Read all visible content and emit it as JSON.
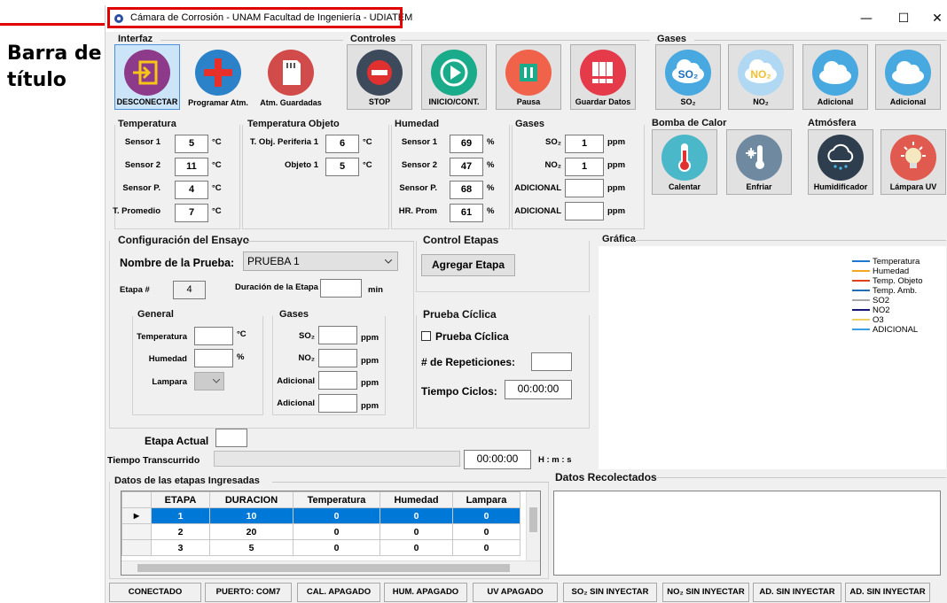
{
  "annotation": {
    "label_line1": "Barra de",
    "label_line2": "título"
  },
  "window": {
    "title": "Cámara de Corrosión - UNAM Facultad de Ingeniería - UDIATEM",
    "minimize": "—",
    "maximize": "☐",
    "close": "✕"
  },
  "groups": {
    "interfaz": "Interfaz",
    "controles": "Controles",
    "gases_top": "Gases",
    "temperatura": "Temperatura",
    "temp_objeto": "Temperatura Objeto",
    "humedad": "Humedad",
    "gases_mid": "Gases",
    "bomba": "Bomba de Calor",
    "atmosfera": "Atmósfera",
    "config": "Configuración del Ensayo",
    "control_etapas": "Control Etapas",
    "grafica": "Gráfica",
    "general": "General",
    "gases_cfg": "Gases",
    "prueba_ciclica": "Prueba Cíclica",
    "datos_etapas": "Datos de las etapas Ingresadas",
    "datos_recolectados": "Datos Recolectados"
  },
  "toolbar": {
    "desconectar": "DESCONECTAR",
    "programar": "Programar Atm.",
    "guardadas": "Atm. Guardadas",
    "stop": "STOP",
    "inicio": "INICIO/CONT.",
    "pausa": "Pausa",
    "guardar_datos": "Guardar Datos",
    "so2": "SO₂",
    "no2": "NO₂",
    "adicional1": "Adicional",
    "adicional2": "Adicional",
    "so2_icon_text": "SO₂",
    "no2_icon_text": "NO₂",
    "calentar": "Calentar",
    "enfriar": "Enfriar",
    "humidificador": "Humidificador",
    "lampara_uv": "Lámpara UV"
  },
  "temperatura": {
    "sensor1_label": "Sensor 1",
    "sensor1_value": "5",
    "sensor1_unit": "°C",
    "sensor2_label": "Sensor 2",
    "sensor2_value": "11",
    "sensor2_unit": "°C",
    "sensorp_label": "Sensor P.",
    "sensorp_value": "4",
    "sensorp_unit": "°C",
    "promedio_label": "T. Promedio",
    "promedio_value": "7",
    "promedio_unit": "°C"
  },
  "temp_objeto": {
    "periferia_label": "T. Obj. Periferia 1",
    "periferia_value": "6",
    "periferia_unit": "°C",
    "objeto_label": "Objeto 1",
    "objeto_value": "5",
    "objeto_unit": "°C"
  },
  "humedad": {
    "sensor1_label": "Sensor 1",
    "sensor1_value": "69",
    "sensor1_unit": "%",
    "sensor2_label": "Sensor 2",
    "sensor2_value": "47",
    "sensor2_unit": "%",
    "sensorp_label": "Sensor P.",
    "sensorp_value": "68",
    "sensorp_unit": "%",
    "prom_label": "HR. Prom",
    "prom_value": "61",
    "prom_unit": "%"
  },
  "gases_mid": {
    "so2_label": "SO₂",
    "so2_value": "1",
    "so2_unit": "ppm",
    "no2_label": "NO₂",
    "no2_value": "1",
    "no2_unit": "ppm",
    "ad1_label": "ADICIONAL",
    "ad1_value": "",
    "ad1_unit": "ppm",
    "ad2_label": "ADICIONAL",
    "ad2_value": "",
    "ad2_unit": "ppm"
  },
  "config": {
    "nombre_label": "Nombre de la Prueba:",
    "nombre_value": "PRUEBA 1",
    "etapa_label": "Etapa #",
    "etapa_value": "4",
    "duracion_label": "Duración de la Etapa",
    "duracion_value": "",
    "duracion_unit": "min",
    "temp_label": "Temperatura",
    "temp_unit": "°C",
    "hum_label": "Humedad",
    "hum_unit": "%",
    "lampara_label": "Lampara",
    "so2_label": "SO₂",
    "no2_label": "NO₂",
    "ad1_label": "Adicional",
    "ad2_label": "Adicional",
    "ppm": "ppm"
  },
  "control_etapas": {
    "agregar": "Agregar Etapa"
  },
  "prueba_ciclica": {
    "checkbox_label": "Prueba Cíclica",
    "repeticiones_label": "# de Repeticiones:",
    "tiempo_label": "Tiempo Ciclos:",
    "tiempo_value": "00:00:00"
  },
  "progress": {
    "etapa_actual_label": "Etapa Actual",
    "etapa_actual_value": "",
    "transcurrido_label": "Tiempo Transcurrido",
    "transcurrido_value": "00:00:00",
    "hms": "H : m : s"
  },
  "legend": [
    {
      "name": "Temperatura",
      "color": "#1f77d4"
    },
    {
      "name": "Humedad",
      "color": "#f5a623"
    },
    {
      "name": "Temp. Objeto",
      "color": "#e0401a"
    },
    {
      "name": "Temp. Amb.",
      "color": "#1e6fb8"
    },
    {
      "name": "SO2",
      "color": "#a8a8a8"
    },
    {
      "name": "NO2",
      "color": "#15157a"
    },
    {
      "name": "O3",
      "color": "#f0d060"
    },
    {
      "name": "ADICIONAL",
      "color": "#3aa0e6"
    }
  ],
  "table": {
    "headers": [
      "ETAPA",
      "DURACION",
      "Temperatura",
      "Humedad",
      "Lampara"
    ],
    "rows": [
      [
        "1",
        "10",
        "0",
        "0",
        "0"
      ],
      [
        "2",
        "20",
        "0",
        "0",
        "0"
      ],
      [
        "3",
        "5",
        "0",
        "0",
        "0"
      ]
    ]
  },
  "status": {
    "conectado": "CONECTADO",
    "puerto": "PUERTO: COM7",
    "cal": "CAL. APAGADO",
    "hum": "HUM. APAGADO",
    "uv": "UV APAGADO",
    "so2": "SO₂ SIN INYECTAR",
    "no2": "NO₂ SIN INYECTAR",
    "ad1": "AD. SIN INYECTAR",
    "ad2": "AD. SIN INYECTAR"
  }
}
